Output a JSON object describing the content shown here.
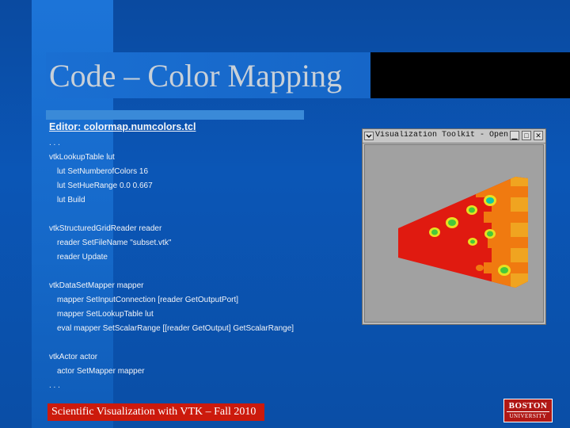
{
  "slide": {
    "title": "Code – Color Mapping",
    "footer": "Scientific Visualization with VTK – Fall 2010"
  },
  "editor": {
    "header": "Editor: colormap.numcolors.tcl",
    "lines": [
      {
        "text": ". . .",
        "indent": false
      },
      {
        "text": "vtkLookupTable lut",
        "indent": false
      },
      {
        "text": "lut SetNumberofColors 16",
        "indent": true
      },
      {
        "text": "lut SetHueRange 0.0 0.667",
        "indent": true
      },
      {
        "text": "lut Build",
        "indent": true
      },
      {
        "text": "",
        "indent": false
      },
      {
        "text": "vtkStructuredGridReader reader",
        "indent": false
      },
      {
        "text": "reader SetFileName \"subset.vtk\"",
        "indent": true
      },
      {
        "text": "reader Update",
        "indent": true
      },
      {
        "text": "",
        "indent": false
      },
      {
        "text": "vtkDataSetMapper mapper",
        "indent": false
      },
      {
        "text": "mapper SetInputConnection [reader GetOutputPort]",
        "indent": true
      },
      {
        "text": "mapper SetLookupTable lut",
        "indent": true
      },
      {
        "text": "eval mapper SetScalarRange [[reader GetOutput] GetScalarRange]",
        "indent": true
      },
      {
        "text": "",
        "indent": false
      },
      {
        "text": "vtkActor actor",
        "indent": false
      },
      {
        "text": "actor SetMapper mapper",
        "indent": true
      },
      {
        "text": ". . .",
        "indent": false
      }
    ]
  },
  "render_window": {
    "title": "Visualization Toolkit - OpenG",
    "menu_icon": "chevron-down-icon",
    "buttons": [
      {
        "icon": "minimize-icon",
        "glyph": "▁"
      },
      {
        "icon": "maximize-icon",
        "glyph": "□"
      },
      {
        "icon": "close-icon",
        "glyph": "✕"
      }
    ]
  },
  "logo": {
    "line1": "BOSTON",
    "line2": "UNIVERSITY"
  },
  "colors": {
    "background": "#0b56b6",
    "footer_red": "#cc1a0c",
    "render_colors": [
      "#e01a10",
      "#f07a10",
      "#f0a420",
      "#e8e020",
      "#46c83a",
      "#10c8a8"
    ]
  }
}
